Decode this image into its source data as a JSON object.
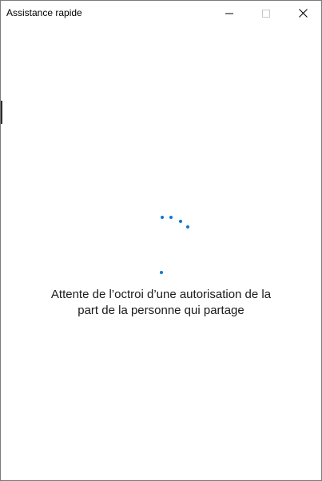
{
  "window": {
    "title": "Assistance rapide",
    "controls": {
      "minimize_icon": "minimize-icon",
      "maximize_icon": "maximize-icon",
      "close_icon": "close-icon"
    }
  },
  "main": {
    "status_line1": "Attente de l’octroi d’une autorisation de la",
    "status_line2": "part de la personne qui partage",
    "spinner_icon": "loading-dots-icon"
  },
  "colors": {
    "accent": "#0a78d7",
    "text": "#1a1a1a",
    "background": "#ffffff"
  }
}
